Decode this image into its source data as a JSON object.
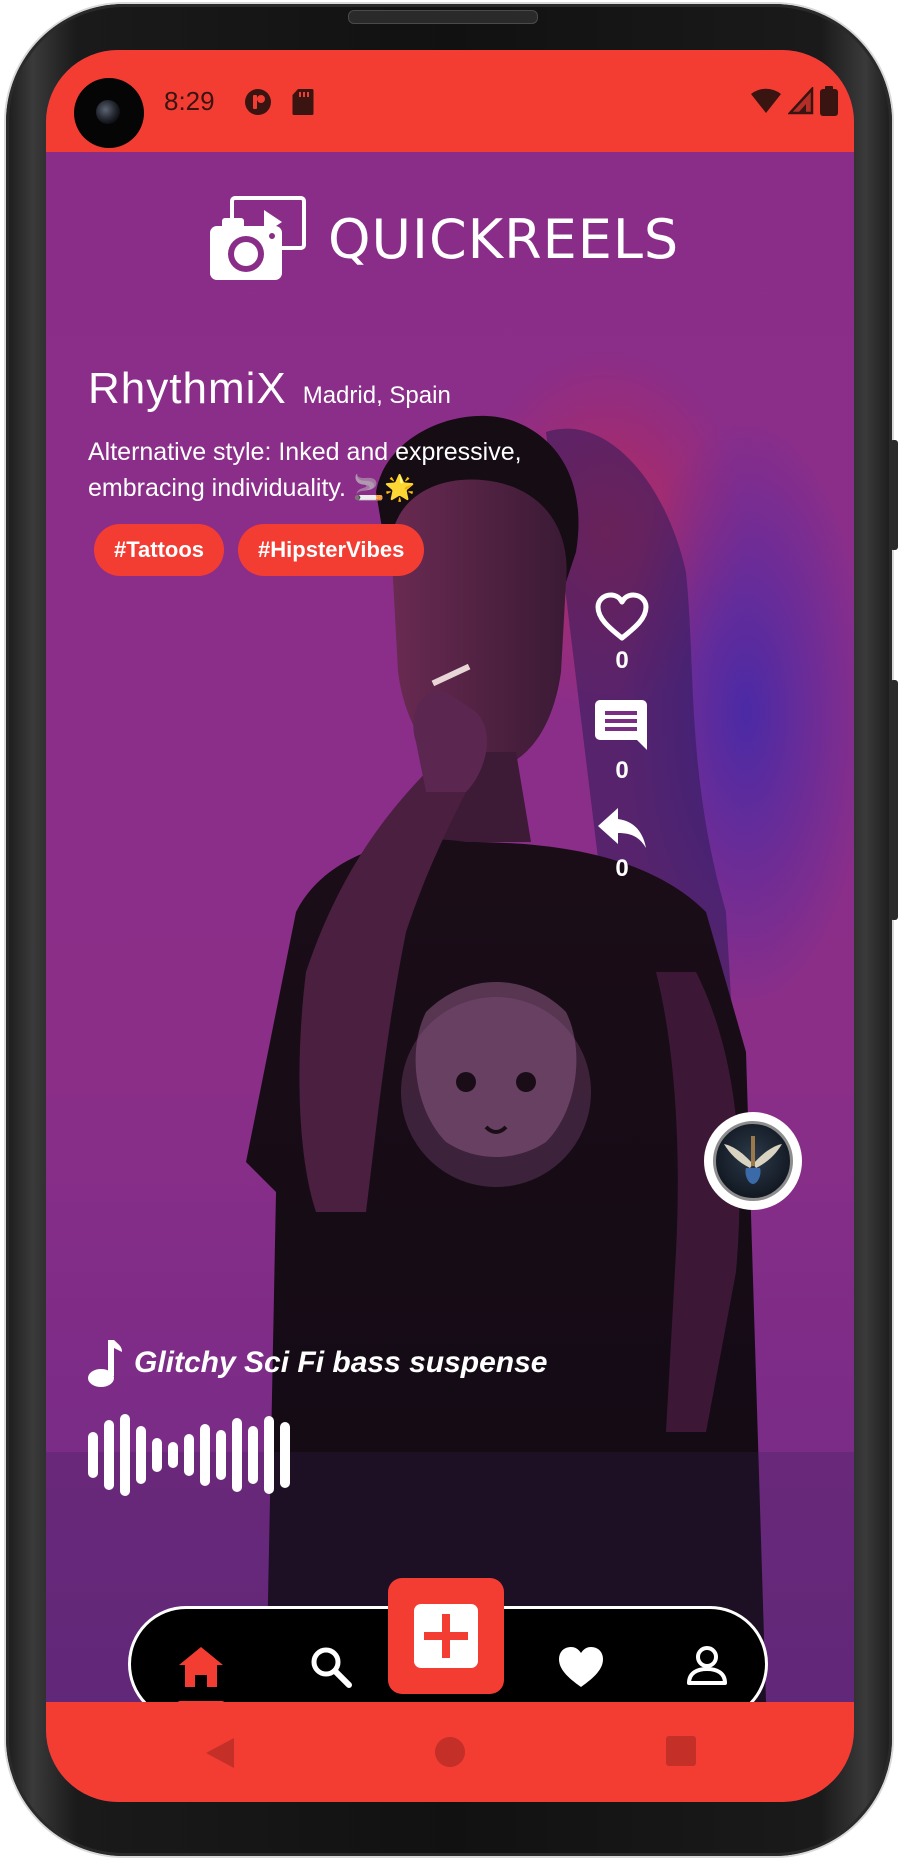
{
  "status_bar": {
    "time": "8:29",
    "icons": [
      "camera-hole",
      "app-notification-icon",
      "sd-card-icon",
      "wifi-icon",
      "signal-icon",
      "battery-icon"
    ]
  },
  "app": {
    "name": "QUICKREELS",
    "logo_icon": "camera-play-icon"
  },
  "post": {
    "username": "RhythmiX",
    "location": "Madrid, Spain",
    "caption": "Alternative style: Inked and expressive, embracing individuality. 🚬🌟",
    "tags": [
      "#Tattoos",
      "#HipsterVibes"
    ]
  },
  "actions": {
    "likes": "0",
    "comments": "0",
    "shares": "0"
  },
  "music": {
    "title": "Glitchy Sci Fi bass suspense",
    "icon": "music-note-icon"
  },
  "nav": {
    "items": [
      "home-icon",
      "search-icon",
      "add-icon",
      "heart-icon",
      "profile-icon"
    ],
    "active": "home"
  },
  "colors": {
    "accent": "#f33d33",
    "background": "#8a2d88",
    "nav": "#000000"
  }
}
